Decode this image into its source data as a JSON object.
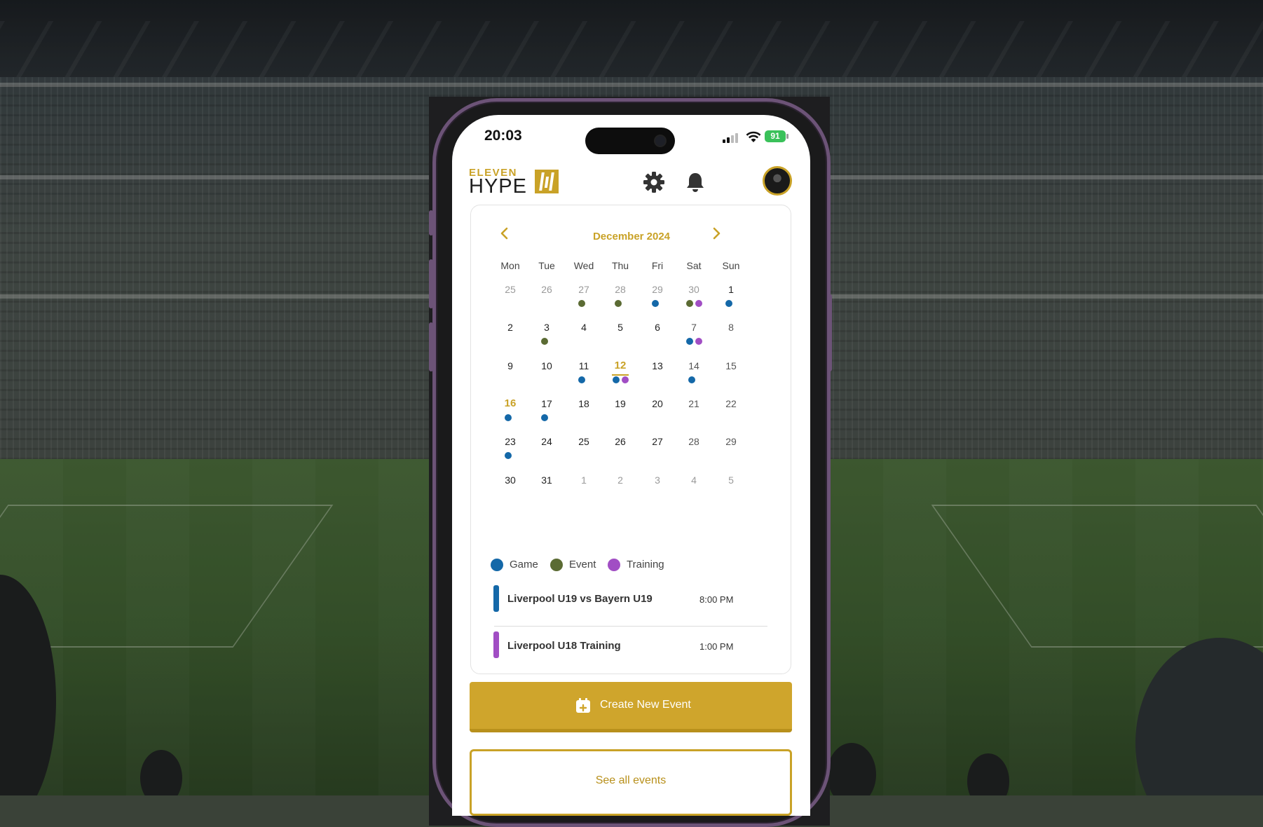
{
  "status_bar": {
    "time": "20:03",
    "battery": "91"
  },
  "brand": {
    "line1": "ELEVEN",
    "line2": "HYPE"
  },
  "header": {
    "settings_icon": "gear-icon",
    "notifications_icon": "bell-icon",
    "avatar": "profile-avatar"
  },
  "calendar": {
    "month_label": "December 2024",
    "weekdays": [
      "Mon",
      "Tue",
      "Wed",
      "Thu",
      "Fri",
      "Sat",
      "Sun"
    ],
    "weeks": [
      [
        {
          "d": "25",
          "muted": true,
          "dots": []
        },
        {
          "d": "26",
          "muted": true,
          "dots": []
        },
        {
          "d": "27",
          "muted": true,
          "dots": [
            "event"
          ]
        },
        {
          "d": "28",
          "muted": true,
          "dots": [
            "event"
          ]
        },
        {
          "d": "29",
          "muted": true,
          "dots": [
            "game"
          ]
        },
        {
          "d": "30",
          "muted": true,
          "dots": [
            "event",
            "training"
          ]
        },
        {
          "d": "1",
          "dots": [
            "game"
          ]
        }
      ],
      [
        {
          "d": "2",
          "dots": []
        },
        {
          "d": "3",
          "dots": [
            "event"
          ]
        },
        {
          "d": "4",
          "dots": []
        },
        {
          "d": "5",
          "dots": []
        },
        {
          "d": "6",
          "dots": []
        },
        {
          "d": "7",
          "weekend": true,
          "dots": [
            "game",
            "training"
          ]
        },
        {
          "d": "8",
          "weekend": true,
          "dots": []
        }
      ],
      [
        {
          "d": "9",
          "dots": []
        },
        {
          "d": "10",
          "dots": []
        },
        {
          "d": "11",
          "dots": [
            "game"
          ]
        },
        {
          "d": "12",
          "highlight": true,
          "underline": true,
          "dots": [
            "game",
            "training"
          ]
        },
        {
          "d": "13",
          "dots": []
        },
        {
          "d": "14",
          "weekend": true,
          "dots": [
            "game"
          ]
        },
        {
          "d": "15",
          "weekend": true,
          "dots": []
        }
      ],
      [
        {
          "d": "16",
          "highlight": true,
          "dots": [
            "game"
          ]
        },
        {
          "d": "17",
          "dots": [
            "game"
          ]
        },
        {
          "d": "18",
          "dots": []
        },
        {
          "d": "19",
          "dots": []
        },
        {
          "d": "20",
          "dots": []
        },
        {
          "d": "21",
          "weekend": true,
          "dots": []
        },
        {
          "d": "22",
          "weekend": true,
          "dots": []
        }
      ],
      [
        {
          "d": "23",
          "dots": [
            "game"
          ]
        },
        {
          "d": "24",
          "dots": []
        },
        {
          "d": "25",
          "dots": []
        },
        {
          "d": "26",
          "dots": []
        },
        {
          "d": "27",
          "dots": []
        },
        {
          "d": "28",
          "weekend": true,
          "dots": []
        },
        {
          "d": "29",
          "weekend": true,
          "dots": []
        }
      ],
      [
        {
          "d": "30",
          "dots": []
        },
        {
          "d": "31",
          "dots": []
        },
        {
          "d": "1",
          "muted": true,
          "dots": []
        },
        {
          "d": "2",
          "muted": true,
          "dots": []
        },
        {
          "d": "3",
          "muted": true,
          "dots": []
        },
        {
          "d": "4",
          "muted": true,
          "dots": []
        },
        {
          "d": "5",
          "muted": true,
          "dots": []
        }
      ]
    ]
  },
  "legend": [
    {
      "key": "game",
      "label": "Game",
      "color": "#1468a8"
    },
    {
      "key": "event",
      "label": "Event",
      "color": "#5b6b33"
    },
    {
      "key": "training",
      "label": "Training",
      "color": "#a14ec4"
    }
  ],
  "events": [
    {
      "title": "Liverpool U19 vs Bayern U19",
      "time": "8:00 PM",
      "type": "game"
    },
    {
      "title": "Liverpool U18  Training",
      "time": "1:00 PM",
      "type": "training"
    }
  ],
  "actions": {
    "create_label": "Create New Event",
    "see_all_label": "See all events"
  },
  "colors": {
    "accent": "#c9a227",
    "button": "#cfa52c",
    "game": "#1468a8",
    "event": "#5b6b33",
    "training": "#a14ec4"
  }
}
